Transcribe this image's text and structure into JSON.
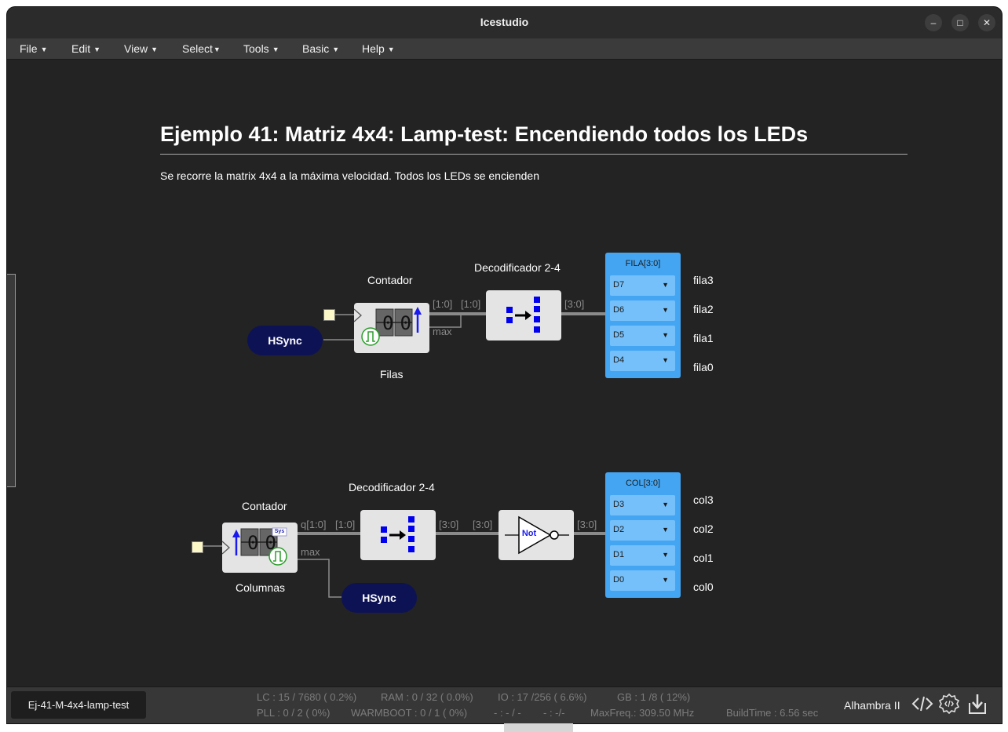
{
  "window": {
    "title": "Icestudio"
  },
  "window_controls": {
    "minimize": "–",
    "maximize": "□",
    "close": "✕"
  },
  "menu": [
    {
      "label": "File"
    },
    {
      "label": "Edit"
    },
    {
      "label": "View"
    },
    {
      "label": "Select"
    },
    {
      "label": "Tools"
    },
    {
      "label": "Basic"
    },
    {
      "label": "Help"
    }
  ],
  "canvas": {
    "title": "Ejemplo 41: Matriz 4x4: Lamp-test: Encendiendo todos los LEDs",
    "description": "Se recorre la matrix 4x4 a la máxima velocidad. Todos los LEDs se encienden",
    "rows_circuit": {
      "counter_title": "Contador",
      "counter_name": "Filas",
      "counter_digits": "00",
      "counter_out_label": "[1:0]",
      "counter_max_label": "max",
      "decoder_title": "Decodificador 2-4",
      "decoder_in_label": "[1:0]",
      "decoder_out_label": "[3:0]",
      "hsync": "HSync",
      "output_header": "FILA[3:0]",
      "pins": [
        "D7",
        "D6",
        "D5",
        "D4"
      ],
      "names": [
        "fila3",
        "fila2",
        "fila1",
        "fila0"
      ]
    },
    "cols_circuit": {
      "counter_title": "Contador",
      "counter_name": "Columnas",
      "counter_digits": "00",
      "counter_badge": "Sys",
      "counter_out_label": "q[1:0]",
      "counter_max_label": "max",
      "decoder_title": "Decodificador 2-4",
      "decoder_in_label": "[1:0]",
      "decoder_out_label": "[3:0]",
      "not_in_label": "[3:0]",
      "not_label": "Not",
      "not_out_label": "[3:0]",
      "hsync": "HSync",
      "output_header": "COL[3:0]",
      "pins": [
        "D3",
        "D2",
        "D1",
        "D0"
      ],
      "names": [
        "col3",
        "col2",
        "col1",
        "col0"
      ]
    }
  },
  "statusbar": {
    "project": "Ej-41-M-4x4-lamp-test",
    "lc": "LC : 15 / 7680 ( 0.2%)",
    "ram": "RAM : 0 / 32 ( 0.0%)",
    "io": "IO :  17 /256  ( 6.6%)",
    "gb": "GB :  1 /8  ( 12%)",
    "pll": "PLL : 0 / 2 ( 0%)",
    "warmboot": "WARMBOOT : 0 / 1 ( 0%)",
    "blank1": "- : - / -",
    "blank2": "- :  -/-",
    "maxfreq": "MaxFreq.:  309.50 MHz",
    "buildtime": "BuildTime :   6.56 sec",
    "board": "Alhambra II"
  },
  "colors": {
    "accent_block": "#44a6f3",
    "hsync": "#0d1254",
    "canvas": "#232323"
  }
}
